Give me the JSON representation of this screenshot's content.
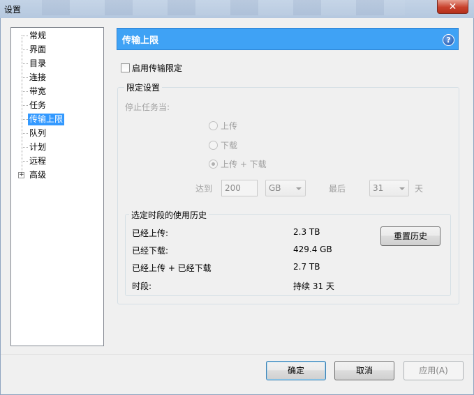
{
  "window": {
    "title": "设置",
    "close_glyph": "✕"
  },
  "sidebar": {
    "items": [
      {
        "label": "常规"
      },
      {
        "label": "界面"
      },
      {
        "label": "目录"
      },
      {
        "label": "连接"
      },
      {
        "label": "带宽"
      },
      {
        "label": "任务"
      },
      {
        "label": "传输上限",
        "selected": true
      },
      {
        "label": "队列"
      },
      {
        "label": "计划"
      },
      {
        "label": "远程"
      },
      {
        "label": "高级",
        "expandable": true
      }
    ],
    "expander_glyph": "+"
  },
  "panel": {
    "title": "传输上限",
    "help_glyph": "?",
    "enable_label": "启用传输限定",
    "enable_checked": false,
    "limit_group": {
      "title": "限定设置",
      "stop_when_label": "停止任务当:",
      "options": [
        {
          "label": "上传",
          "checked": false
        },
        {
          "label": "下载",
          "checked": false
        },
        {
          "label": "上传 + 下载",
          "checked": true
        }
      ],
      "reach_label": "达到",
      "amount_value": "200",
      "unit_value": "GB",
      "last_label": "最后",
      "days_value": "31",
      "days_unit_label": "天"
    },
    "history_group": {
      "title": "选定时段的使用历史",
      "rows": [
        {
          "label": "已经上传:",
          "value": "2.3 TB"
        },
        {
          "label": "已经下载:",
          "value": "429.4 GB"
        },
        {
          "label": "已经上传 + 已经下载",
          "value": "2.7 TB"
        },
        {
          "label": "时段:",
          "value": "持续 31 天"
        }
      ],
      "reset_label": "重置历史"
    }
  },
  "footer": {
    "ok_label": "确定",
    "cancel_label": "取消",
    "apply_label": "应用(A)"
  },
  "colors": {
    "header_bg": "#3fa2f5",
    "selection_bg": "#3399ff",
    "close_bg": "#c8412c"
  }
}
